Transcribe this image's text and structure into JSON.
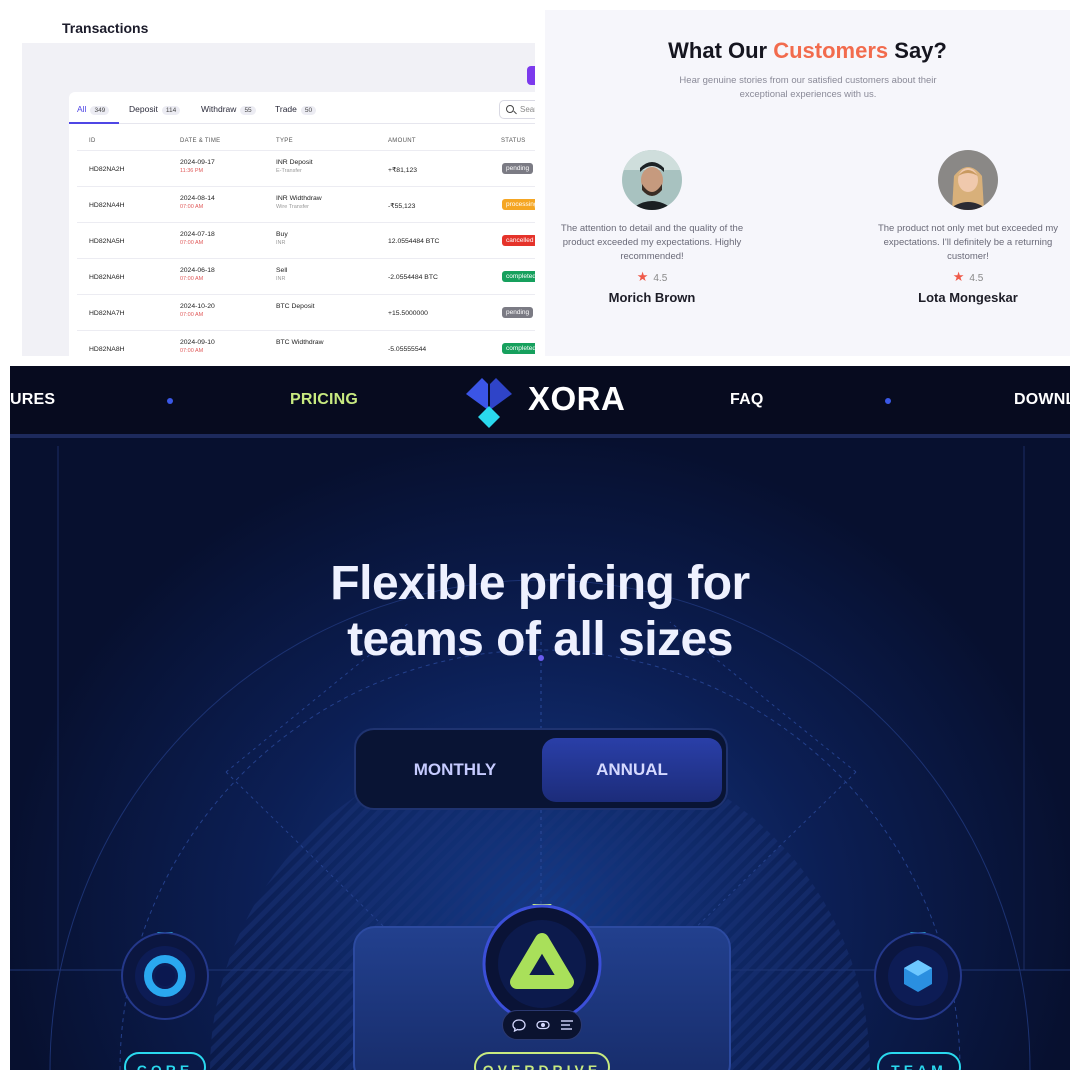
{
  "transactions": {
    "title": "Transactions",
    "tabs": [
      {
        "label": "All",
        "count": "349"
      },
      {
        "label": "Deposit",
        "count": "114"
      },
      {
        "label": "Withdraw",
        "count": "55"
      },
      {
        "label": "Trade",
        "count": "50"
      }
    ],
    "search_placeholder": "Sear",
    "headers": [
      "ID",
      "DATE & TIME",
      "TYPE",
      "AMOUNT",
      "STATUS"
    ],
    "rows": [
      {
        "id": "HD82NA2H",
        "date": "2024-09-17",
        "time": "11:36 PM",
        "type": "INR Deposit",
        "method": "E-Transfer",
        "amount": "+₹81,123",
        "status": "pending",
        "status_color": "#7b7b84"
      },
      {
        "id": "HD82NA4H",
        "date": "2024-08-14",
        "time": "07:00 AM",
        "type": "INR Widthdraw",
        "method": "Wire Transfer",
        "amount": "-₹55,123",
        "status": "processing",
        "status_color": "#f5a623"
      },
      {
        "id": "HD82NA5H",
        "date": "2024-07-18",
        "time": "07:00 AM",
        "type": "Buy",
        "method": "INR",
        "amount": "12.0554484 BTC",
        "status": "cancelled",
        "status_color": "#e5332a"
      },
      {
        "id": "HD82NA6H",
        "date": "2024-06-18",
        "time": "07:00 AM",
        "type": "Sell",
        "method": "INR",
        "amount": "-2.0554484 BTC",
        "status": "completed",
        "status_color": "#16a05d"
      },
      {
        "id": "HD82NA7H",
        "date": "2024-10-20",
        "time": "07:00 AM",
        "type": "BTC Deposit",
        "method": "",
        "amount": "+15.5000000",
        "status": "pending",
        "status_color": "#7b7b84"
      },
      {
        "id": "HD82NA8H",
        "date": "2024-09-10",
        "time": "07:00 AM",
        "type": "BTC Widthdraw",
        "method": "",
        "amount": "-5.05555544",
        "status": "completed",
        "status_color": "#16a05d"
      }
    ]
  },
  "testimonials": {
    "heading_prefix": "What Our ",
    "heading_accent": "Customers",
    "heading_suffix": " Say?",
    "subheading": "Hear genuine stories from our satisfied customers about their exceptional experiences with us.",
    "reviews": [
      {
        "quote": "The attention to detail and the quality of the product exceeded my expectations. Highly recommended!",
        "rating": "4.5",
        "name": "Morich Brown"
      },
      {
        "quote": "The product not only met but exceeded my expectations. I'll definitely be a returning customer!",
        "rating": "4.5",
        "name": "Lota Mongeskar"
      }
    ]
  },
  "xora": {
    "nav": {
      "left_cut": "URES",
      "pricing": "PRICING",
      "logo": "XORA",
      "faq": "FAQ",
      "right_cut": "DOWNL"
    },
    "hero_title": "Flexible pricing for teams of all sizes",
    "toggle": {
      "monthly": "MONTHLY",
      "annual": "ANNUAL"
    },
    "plans": [
      "CORE",
      "OVERDRIVE",
      "TEAM"
    ],
    "colors": {
      "accent_green": "#c8ea80",
      "accent_cyan": "#2ad9ee",
      "bg": "#07102f"
    }
  }
}
